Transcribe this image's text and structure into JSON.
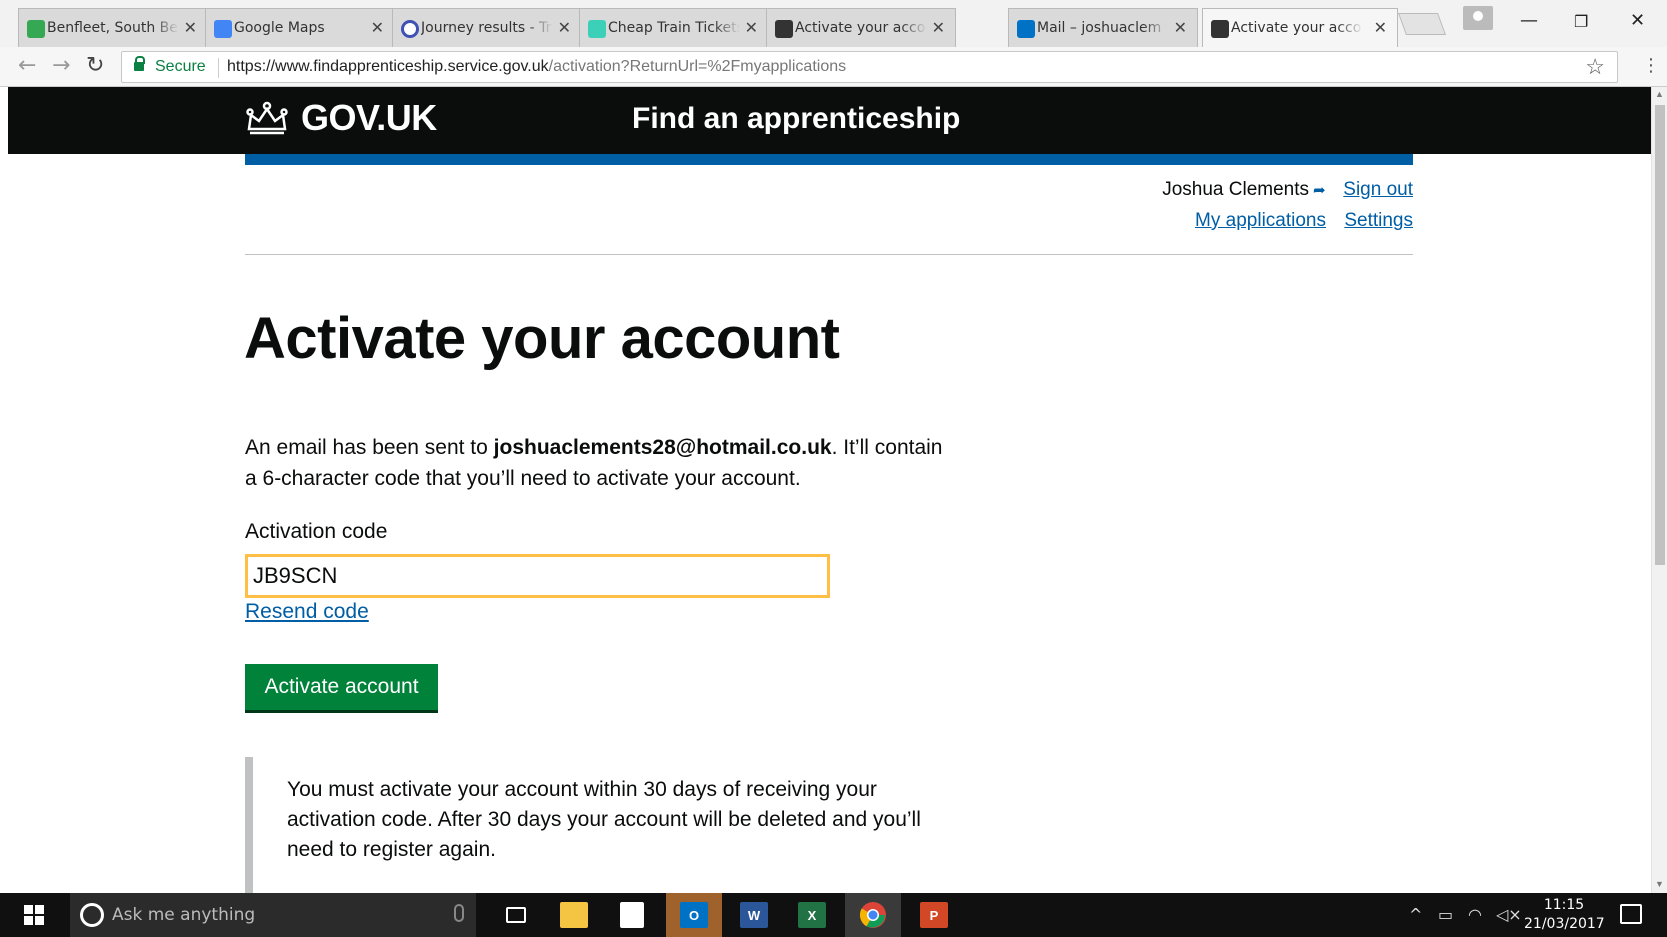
{
  "browser": {
    "tabs": [
      {
        "title": "Benfleet, South Ben",
        "favicon": "maps-icon",
        "active": false
      },
      {
        "title": "Google Maps",
        "favicon": "maps-icon",
        "active": false
      },
      {
        "title": "Journey results - Tr",
        "favicon": "journey-icon",
        "active": false
      },
      {
        "title": "Cheap Train Tickets",
        "favicon": "trainline-icon",
        "active": false
      },
      {
        "title": "Activate your acco",
        "favicon": "govuk-crown-icon",
        "active": false
      },
      {
        "title": "Mail – joshuaclem",
        "favicon": "outlook-icon",
        "active": false
      },
      {
        "title": "Activate your acco",
        "favicon": "govuk-crown-icon",
        "active": true
      }
    ],
    "close_glyph": "✕",
    "secure_label": "Secure",
    "url_base": "https://www.findapprenticeship.service.gov.uk",
    "url_rest": "/activation?ReturnUrl=%2Fmyapplications"
  },
  "header": {
    "logo_text": "GOV.UK",
    "service_name": "Find an apprenticeship"
  },
  "user_nav": {
    "username": "Joshua Clements",
    "sign_out": "Sign out",
    "my_applications": "My applications",
    "settings": "Settings"
  },
  "main": {
    "title": "Activate your account",
    "intro_before": "An email has been sent to ",
    "email": "joshuaclements28@hotmail.co.uk",
    "intro_after": ". It’ll contain a 6-character code that you’ll need to activate your account.",
    "code_label": "Activation code",
    "code_value": "JB9SCN",
    "resend_link": "Resend code",
    "submit_label": "Activate account",
    "inset_text": "You must activate your account within 30 days of receiving your activation code. After 30 days your account will be deleted and you’ll need to register again."
  },
  "taskbar": {
    "search_placeholder": "Ask me anything",
    "apps": [
      "task-view",
      "file-explorer",
      "store",
      "outlook",
      "word",
      "excel",
      "chrome",
      "powerpoint"
    ],
    "time": "11:15",
    "date": "21/03/2017"
  },
  "colors": {
    "govuk_black": "#0b0c0c",
    "govuk_blue": "#005ea5",
    "button_green": "#00823b",
    "focus_yellow": "#ffbf47"
  }
}
